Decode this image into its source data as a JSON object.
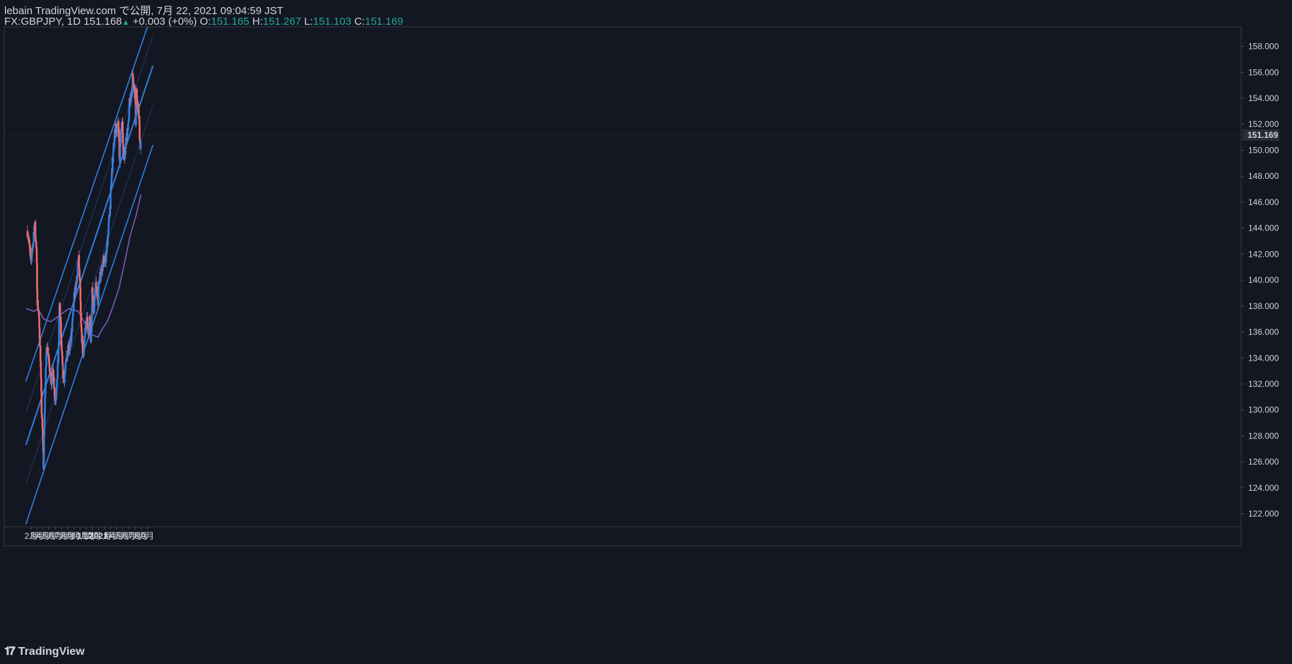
{
  "header": {
    "publish_line": "lebain TradingView.com で公開, 7月 22, 2021 09:04:59 JST",
    "symbol": "FX:GBPJPY, 1D",
    "last": "151.168",
    "change": "+0.003 (+0%)",
    "o_label": "O:",
    "o_value": "151.165",
    "h_label": "H:",
    "h_value": "151.267",
    "l_label": "L:",
    "l_value": "151.103",
    "c_label": "C:",
    "c_value": "151.169"
  },
  "brand": {
    "name": "TradingView",
    "icon": "tradingview-logo-icon"
  },
  "colors": {
    "background": "#131722",
    "up": "#2f7fe0",
    "down": "#ef6c6c",
    "channel": "#2f7fe0",
    "ma": "#7e57c2",
    "price_label_bg": "#2a2e39"
  },
  "chart_data": {
    "type": "candlestick",
    "symbol": "FX:GBPJPY",
    "interval": "1D",
    "ylim": [
      121,
      159.5
    ],
    "y_ticks": [
      "158.000",
      "156.000",
      "154.000",
      "152.000",
      "150.000",
      "148.000",
      "146.000",
      "144.000",
      "142.000",
      "140.000",
      "138.000",
      "136.000",
      "134.000",
      "132.000",
      "130.000",
      "128.000",
      "126.000",
      "124.000",
      "122.000"
    ],
    "x_tick_labels": [
      "2月",
      "3月",
      "4月",
      "5月",
      "6月",
      "7月",
      "8月",
      "9月",
      "10月",
      "11月",
      "12月",
      "2021",
      "2月",
      "3月",
      "4月",
      "5月",
      "6月",
      "7月",
      "8月",
      "9月"
    ],
    "current_price_label": "151.169",
    "current_price": 151.169,
    "price_path": [
      [
        "2020-01-14",
        143.8
      ],
      [
        "2020-01-25",
        142.3
      ],
      [
        "2020-02-01",
        141.6
      ],
      [
        "2020-02-10",
        142.7
      ],
      [
        "2020-02-20",
        144.4
      ],
      [
        "2020-02-28",
        142.0
      ],
      [
        "2020-03-03",
        138.5
      ],
      [
        "2020-03-10",
        137.3
      ],
      [
        "2020-03-18",
        134.4
      ],
      [
        "2020-03-24",
        130.0
      ],
      [
        "2020-03-31",
        127.5
      ],
      [
        "2020-04-03",
        125.6
      ],
      [
        "2020-04-08",
        129.5
      ],
      [
        "2020-04-14",
        133.5
      ],
      [
        "2020-04-21",
        135.0
      ],
      [
        "2020-04-28",
        134.3
      ],
      [
        "2020-05-05",
        133.0
      ],
      [
        "2020-05-12",
        131.8
      ],
      [
        "2020-05-19",
        133.0
      ],
      [
        "2020-05-26",
        131.5
      ],
      [
        "2020-06-02",
        130.5
      ],
      [
        "2020-06-09",
        132.0
      ],
      [
        "2020-06-16",
        134.5
      ],
      [
        "2020-06-21",
        138.3
      ],
      [
        "2020-06-26",
        137.0
      ],
      [
        "2020-06-30",
        135.0
      ],
      [
        "2020-07-07",
        133.0
      ],
      [
        "2020-07-14",
        132.3
      ],
      [
        "2020-07-21",
        133.2
      ],
      [
        "2020-07-28",
        134.3
      ],
      [
        "2020-08-04",
        135.0
      ],
      [
        "2020-08-11",
        134.8
      ],
      [
        "2020-08-18",
        135.5
      ],
      [
        "2020-08-25",
        136.8
      ],
      [
        "2020-09-01",
        138.5
      ],
      [
        "2020-09-08",
        139.3
      ],
      [
        "2020-09-15",
        140.0
      ],
      [
        "2020-09-22",
        141.3
      ],
      [
        "2020-09-25",
        141.5
      ],
      [
        "2020-10-01",
        139.5
      ],
      [
        "2020-10-06",
        136.5
      ],
      [
        "2020-10-13",
        135.0
      ],
      [
        "2020-10-17",
        134.0
      ],
      [
        "2020-10-21",
        134.8
      ],
      [
        "2020-10-27",
        136.2
      ],
      [
        "2020-11-03",
        137.0
      ],
      [
        "2020-11-08",
        136.5
      ],
      [
        "2020-11-14",
        136.0
      ],
      [
        "2020-11-19",
        137.0
      ],
      [
        "2020-11-24",
        135.5
      ],
      [
        "2020-11-27",
        136.0
      ],
      [
        "2020-12-01",
        139.5
      ],
      [
        "2020-12-05",
        138.0
      ],
      [
        "2020-12-11",
        137.8
      ],
      [
        "2020-12-16",
        139.5
      ],
      [
        "2020-12-22",
        139.3
      ],
      [
        "2020-12-29",
        138.5
      ],
      [
        "2021-01-04",
        140.0
      ],
      [
        "2021-01-11",
        140.5
      ],
      [
        "2021-01-18",
        141.0
      ],
      [
        "2021-01-25",
        141.5
      ],
      [
        "2021-02-01",
        141.3
      ],
      [
        "2021-02-08",
        141.8
      ],
      [
        "2021-02-15",
        143.2
      ],
      [
        "2021-02-22",
        144.5
      ],
      [
        "2021-03-01",
        146.0
      ],
      [
        "2021-03-07",
        148.0
      ],
      [
        "2021-03-14",
        149.5
      ],
      [
        "2021-03-21",
        151.0
      ],
      [
        "2021-03-28",
        151.8
      ],
      [
        "2021-04-03",
        151.5
      ],
      [
        "2021-04-10",
        152.0
      ],
      [
        "2021-04-16",
        149.0
      ],
      [
        "2021-04-22",
        151.0
      ],
      [
        "2021-04-29",
        152.5
      ],
      [
        "2021-05-03",
        150.0
      ],
      [
        "2021-05-10",
        149.5
      ],
      [
        "2021-05-17",
        150.5
      ],
      [
        "2021-05-24",
        151.5
      ],
      [
        "2021-05-30",
        152.0
      ],
      [
        "2021-06-03",
        153.8
      ],
      [
        "2021-06-10",
        154.2
      ],
      [
        "2021-06-15",
        154.0
      ],
      [
        "2021-06-19",
        155.6
      ],
      [
        "2021-06-25",
        154.8
      ],
      [
        "2021-07-01",
        154.7
      ],
      [
        "2021-07-05",
        152.0
      ],
      [
        "2021-07-09",
        154.5
      ],
      [
        "2021-07-13",
        153.3
      ],
      [
        "2021-07-17",
        153.0
      ],
      [
        "2021-07-21",
        152.6
      ],
      [
        "2021-07-25",
        150.8
      ],
      [
        "2021-07-28",
        149.8
      ],
      [
        "2021-07-31",
        151.2
      ]
    ],
    "ma_line": {
      "color": "#7e57c2",
      "points": [
        [
          "2020-01-06",
          137.8
        ],
        [
          "2020-02-17",
          137.6
        ],
        [
          "2020-03-06",
          137.8
        ],
        [
          "2020-04-04",
          137.0
        ],
        [
          "2020-05-09",
          136.8
        ],
        [
          "2020-06-05",
          137.1
        ],
        [
          "2020-07-10",
          137.5
        ],
        [
          "2020-08-06",
          137.8
        ],
        [
          "2020-09-23",
          137.6
        ],
        [
          "2020-10-31",
          136.5
        ],
        [
          "2020-11-29",
          135.8
        ],
        [
          "2020-12-29",
          135.6
        ],
        [
          "2021-01-18",
          136.2
        ],
        [
          "2021-02-13",
          136.8
        ],
        [
          "2021-03-05",
          137.6
        ],
        [
          "2021-04-13",
          139.4
        ],
        [
          "2021-05-10",
          141.3
        ],
        [
          "2021-06-07",
          143.4
        ],
        [
          "2021-07-07",
          145.0
        ],
        [
          "2021-07-31",
          146.6
        ]
      ]
    },
    "channel": {
      "color": "#2f7fe0",
      "upper": [
        [
          "2020-01-06",
          132.2
        ],
        [
          "2021-09-01",
          159.5
        ]
      ],
      "middle": [
        [
          "2020-01-06",
          127.3
        ],
        [
          "2021-09-28",
          156.5
        ]
      ],
      "lower": [
        [
          "2020-01-06",
          121.2
        ],
        [
          "2021-09-28",
          150.4
        ]
      ],
      "sub_upper": [
        [
          "2020-01-06",
          129.8
        ],
        [
          "2021-09-28",
          158.8
        ]
      ],
      "sub_lower": [
        [
          "2020-01-06",
          124.3
        ],
        [
          "2021-09-28",
          153.5
        ]
      ]
    }
  }
}
